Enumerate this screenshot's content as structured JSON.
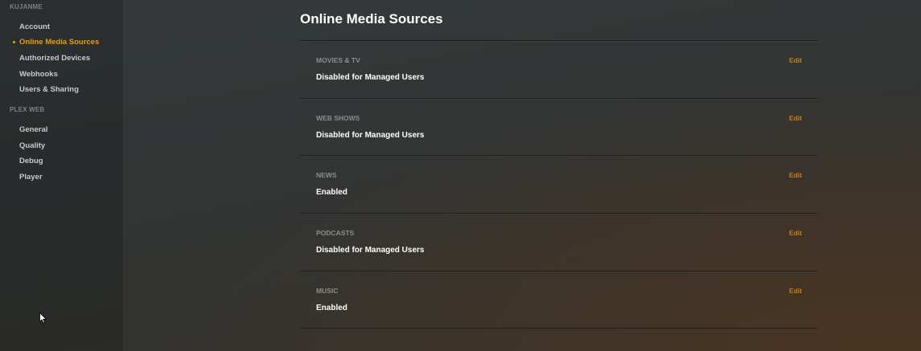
{
  "sidebar": {
    "account_header": "KUJANME",
    "account_items": [
      {
        "label": "Account",
        "active": false
      },
      {
        "label": "Online Media Sources",
        "active": true
      },
      {
        "label": "Authorized Devices",
        "active": false
      },
      {
        "label": "Webhooks",
        "active": false
      },
      {
        "label": "Users & Sharing",
        "active": false
      }
    ],
    "web_header": "PLEX WEB",
    "web_items": [
      {
        "label": "General"
      },
      {
        "label": "Quality"
      },
      {
        "label": "Debug"
      },
      {
        "label": "Player"
      }
    ]
  },
  "main": {
    "title": "Online Media Sources",
    "sources": [
      {
        "name": "MOVIES & TV",
        "status": "Disabled for Managed Users",
        "edit_label": "Edit"
      },
      {
        "name": "WEB SHOWS",
        "status": "Disabled for Managed Users",
        "edit_label": "Edit"
      },
      {
        "name": "NEWS",
        "status": "Enabled",
        "edit_label": "Edit"
      },
      {
        "name": "PODCASTS",
        "status": "Disabled for Managed Users",
        "edit_label": "Edit"
      },
      {
        "name": "MUSIC",
        "status": "Enabled",
        "edit_label": "Edit"
      }
    ]
  },
  "colors": {
    "accent": "#e5a00d",
    "edit": "#cc7b19"
  },
  "icons": {
    "cursor": "mouse-pointer-icon"
  }
}
